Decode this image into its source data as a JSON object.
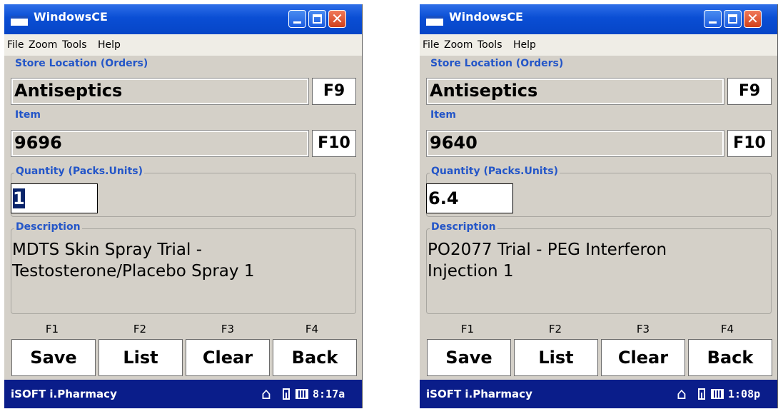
{
  "screens": [
    {
      "window_title": "WindowsCE",
      "menu": [
        "File",
        "Zoom",
        "Tools",
        "Help"
      ],
      "store_location": {
        "legend": "Store Location (Orders)",
        "value": "Antiseptics",
        "key": "F9"
      },
      "item": {
        "legend": "Item",
        "value": "9696",
        "key": "F10"
      },
      "quantity": {
        "legend": "Quantity (Packs.Units)",
        "value": "1"
      },
      "description": {
        "legend": "Description",
        "lines": [
          "MDTS Skin Spray Trial -",
          "Testosterone/Placebo  Spray 1"
        ]
      },
      "function_keys": [
        "F1",
        "F2",
        "F3",
        "F4"
      ],
      "buttons": [
        "Save",
        "List",
        "Clear",
        "Back"
      ],
      "taskbar": {
        "app": "iSOFT i.Pharmacy",
        "time": "8:17a"
      }
    },
    {
      "window_title": "WindowsCE",
      "menu": [
        "File",
        "Zoom",
        "Tools",
        "Help"
      ],
      "store_location": {
        "legend": "Store Location (Orders)",
        "value": "Antiseptics",
        "key": "F9"
      },
      "item": {
        "legend": "Item",
        "value": "9640",
        "key": "F10"
      },
      "quantity": {
        "legend": "Quantity (Packs.Units)",
        "value": "6.4"
      },
      "description": {
        "legend": "Description",
        "lines": [
          "PO2077 Trial - PEG Interferon",
          "Injection 1"
        ]
      },
      "function_keys": [
        "F1",
        "F2",
        "F3",
        "F4"
      ],
      "buttons": [
        "Save",
        "List",
        "Clear",
        "Back"
      ],
      "taskbar": {
        "app": "iSOFT i.Pharmacy",
        "time": "1:08p"
      }
    }
  ],
  "colors": {
    "titlebar": "#0a4ed4",
    "taskbar": "#0a1d8a",
    "legend": "#2456c8",
    "selection": "#0a246a"
  },
  "icons": [
    "window-icon",
    "minimize-icon",
    "maximize-icon",
    "close-icon",
    "home-icon",
    "battery-icon",
    "keyboard-icon"
  ]
}
